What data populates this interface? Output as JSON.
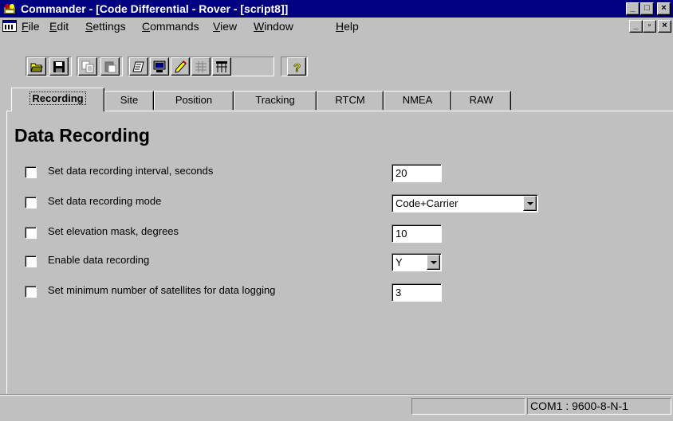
{
  "window": {
    "title": "Commander - [Code Differential - Rover - [script8]]",
    "minimize_glyph": "_",
    "maximize_glyph": "□",
    "close_glyph": "×",
    "restore_glyph": "▫",
    "accent_color": "#000080"
  },
  "menu": {
    "items": [
      {
        "label": "File",
        "mnemonic": "F"
      },
      {
        "label": "Edit",
        "mnemonic": "E"
      },
      {
        "label": "Settings",
        "mnemonic": "S"
      },
      {
        "label": "Commands",
        "mnemonic": "C"
      },
      {
        "label": "View",
        "mnemonic": "V"
      },
      {
        "label": "Window",
        "mnemonic": "W"
      },
      {
        "label": "Help",
        "mnemonic": "H"
      }
    ]
  },
  "toolbar": {
    "buttons": [
      {
        "icon": "open-folder-icon"
      },
      {
        "icon": "save-disk-icon"
      },
      {
        "icon": "copy-icon"
      },
      {
        "icon": "paste-icon"
      },
      {
        "icon": "script-icon"
      },
      {
        "icon": "monitor-icon"
      },
      {
        "icon": "pencil-icon"
      },
      {
        "icon": "grid-icon"
      },
      {
        "icon": "table-icon"
      },
      {
        "icon": "help-question-icon"
      }
    ]
  },
  "tabs": [
    "Recording",
    "Site",
    "Position",
    "Tracking",
    "RTCM",
    "NMEA",
    "RAW"
  ],
  "active_tab": "Recording",
  "page": {
    "heading": "Data Recording",
    "rows": [
      {
        "label": "Set data recording interval, seconds",
        "checked": false,
        "control": "text",
        "value": "20"
      },
      {
        "label": "Set data recording mode",
        "checked": false,
        "control": "combo",
        "value": "Code+Carrier"
      },
      {
        "label": "Set elevation mask, degrees",
        "checked": false,
        "control": "text",
        "value": "10"
      },
      {
        "label": "Enable data recording",
        "checked": false,
        "control": "combo",
        "value": "Y"
      },
      {
        "label": "Set minimum number of satellites for data logging",
        "checked": false,
        "control": "text",
        "value": "3"
      }
    ]
  },
  "status": {
    "pane1": "",
    "pane2": "COM1 : 9600-8-N-1"
  }
}
